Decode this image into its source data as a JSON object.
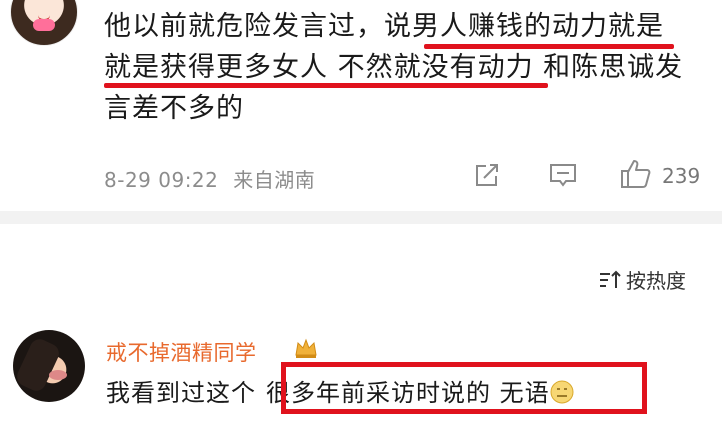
{
  "comment1": {
    "line1": "他以前就危险发言过，说男人赚钱的动力就是",
    "line2": "就是获得更多女人 不然就没有动力 和陈思诚发",
    "line3": "言差不多的",
    "date": "8-29 09:22",
    "location": "来自湖南",
    "like_count": "239"
  },
  "sort": {
    "label": "按热度"
  },
  "comment2": {
    "username": "戒不掉酒精同学",
    "text_before": "我看到过这个",
    "text_highlight": "很多年前采访时说的 无语"
  },
  "colors": {
    "username": "#e8692d",
    "highlight": "#e0121d",
    "meta": "#8c8c8c"
  },
  "icons": [
    "share-icon",
    "comment-icon",
    "like-icon",
    "sort-icon",
    "crown-icon",
    "emoji-icon"
  ]
}
